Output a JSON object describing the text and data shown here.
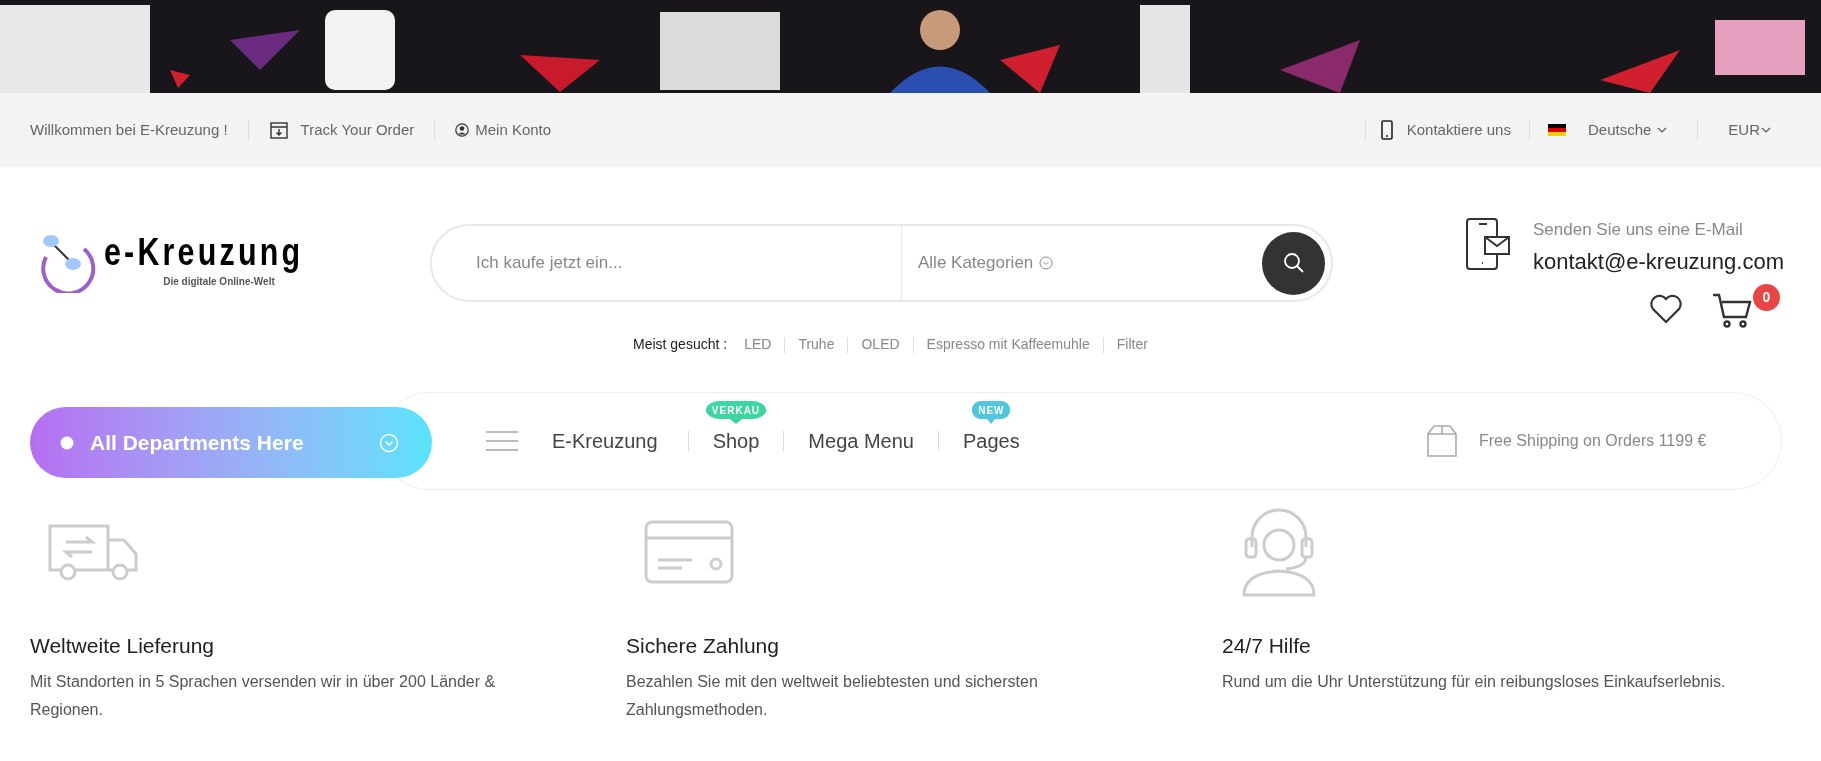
{
  "top_bar": {
    "welcome": "Willkommen bei E-Kreuzung !",
    "track_order": "Track Your Order",
    "account": "Mein Konto",
    "contact": "Kontaktiere uns",
    "language": "Deutsche",
    "currency": "EUR"
  },
  "logo": {
    "name": "e-Kreuzung",
    "tagline": "Die digitale Online-Welt"
  },
  "search": {
    "placeholder": "Ich kaufe jetzt ein...",
    "category": "Alle Kategorien"
  },
  "contact": {
    "label": "Senden Sie uns eine E-Mail",
    "email": "kontakt@e-kreuzung.com"
  },
  "cart": {
    "count": "0"
  },
  "popular": {
    "label": "Meist gesucht :",
    "terms": [
      "LED",
      "Truhe",
      "OLED",
      "Espresso mit Kaffeemuhle",
      "Filter"
    ]
  },
  "departments": {
    "label": "All Departments Here"
  },
  "nav": [
    {
      "label": "E-Kreuzung"
    },
    {
      "label": "Shop",
      "badge": "VERKAU",
      "color": "#3ed6a0"
    },
    {
      "label": "Mega Menu"
    },
    {
      "label": "Pages",
      "badge": "NEW",
      "color": "#4fc6de"
    }
  ],
  "shipping": "Free Shipping on Orders 1199 €",
  "features": [
    {
      "kind": "truck",
      "title": "Weltweite Lieferung",
      "text": "Mit Standorten in 5 Sprachen versenden wir in über 200 Länder & Regionen."
    },
    {
      "kind": "card",
      "title": "Sichere Zahlung",
      "text": "Bezahlen Sie mit den weltweit beliebtesten und sichersten Zahlungsmethoden."
    },
    {
      "kind": "headset",
      "title": "24/7 Hilfe",
      "text": "Rund um die Uhr Unterstützung für ein reibungsloses Einkaufserlebnis."
    }
  ]
}
